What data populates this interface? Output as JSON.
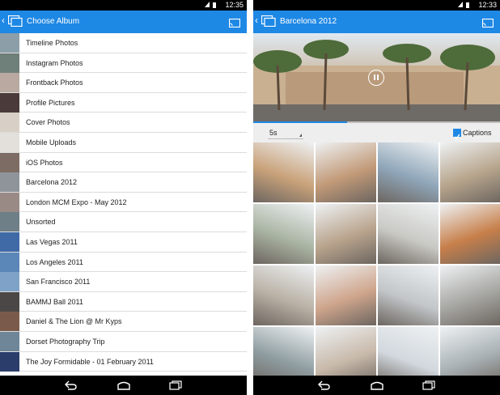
{
  "status_bar": {
    "time_left": "12:35",
    "time_right": "12:33"
  },
  "left_screen": {
    "title": "Choose Album",
    "albums": [
      {
        "label": "Timeline Photos",
        "thumb": "#8c9ea8"
      },
      {
        "label": "Instagram Photos",
        "thumb": "#6f7f7a"
      },
      {
        "label": "Frontback Photos",
        "thumb": "#b9a9a0"
      },
      {
        "label": "Profile Pictures",
        "thumb": "#4a3a3a"
      },
      {
        "label": "Cover Photos",
        "thumb": "#d8d0c6"
      },
      {
        "label": "Mobile Uploads",
        "thumb": "#e3e0dc"
      },
      {
        "label": "iOS Photos",
        "thumb": "#7d6c63"
      },
      {
        "label": "Barcelona 2012",
        "thumb": "#8e949a"
      },
      {
        "label": "London MCM Expo - May 2012",
        "thumb": "#9a8a86"
      },
      {
        "label": "Unsorted",
        "thumb": "#6e7f88"
      },
      {
        "label": "Las Vegas 2011",
        "thumb": "#3f6aa6"
      },
      {
        "label": "Los Angeles 2011",
        "thumb": "#5b86b8"
      },
      {
        "label": "San Francisco 2011",
        "thumb": "#7fa3c8"
      },
      {
        "label": "BAMMJ Ball 2011",
        "thumb": "#4b4747"
      },
      {
        "label": "Daniel & The Lion @ Mr Kyps",
        "thumb": "#7a5b4b"
      },
      {
        "label": "Dorset Photography Trip",
        "thumb": "#6f8598"
      },
      {
        "label": "The Joy Formidable - 01 February 2011",
        "thumb": "#2b3d6b"
      }
    ]
  },
  "right_screen": {
    "title": "Barcelona 2012",
    "interval": "5s",
    "captions_label": "Captions",
    "captions_checked": true,
    "slideshow_progress": 0.38,
    "photos": [
      {
        "color": "#c9a27a"
      },
      {
        "color": "#c29a78"
      },
      {
        "color": "#8fa6b9"
      },
      {
        "color": "#b7a58c"
      },
      {
        "color": "#aab4a3"
      },
      {
        "color": "#b9a48d"
      },
      {
        "color": "#c9c9c4"
      },
      {
        "color": "#c77f4a"
      },
      {
        "color": "#b9b1a5"
      },
      {
        "color": "#cfa58c"
      },
      {
        "color": "#c2c6c9"
      },
      {
        "color": "#a6a6a2"
      },
      {
        "color": "#8f9da1"
      },
      {
        "color": "#c8b9aa"
      },
      {
        "color": "#d2d8de"
      },
      {
        "color": "#a9b1b5"
      }
    ]
  },
  "colors": {
    "accent": "#1e88e5",
    "nav_bar": "#000000"
  }
}
